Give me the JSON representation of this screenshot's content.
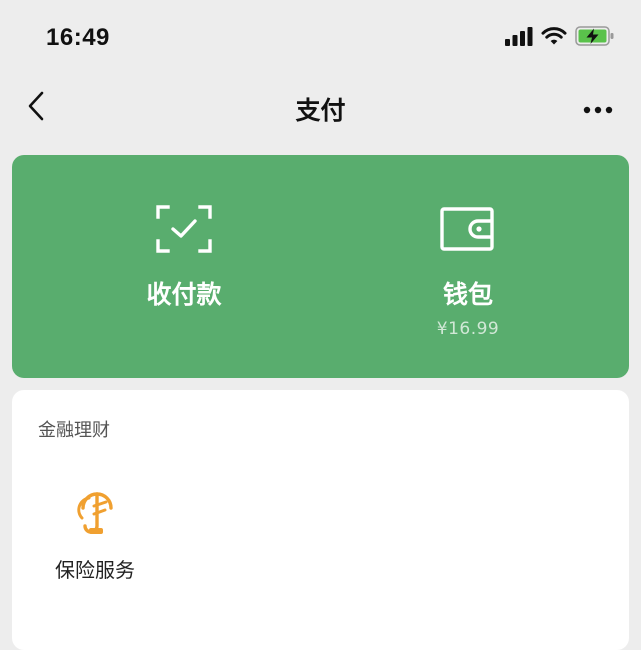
{
  "status_bar": {
    "time": "16:49",
    "icons": [
      "cellular-signal-icon",
      "wifi-icon",
      "battery-charging-icon"
    ],
    "battery_color": "#5ac24b"
  },
  "nav": {
    "title": "支付",
    "back_icon": "chevron-left-icon",
    "more_icon": "more-dots-icon"
  },
  "pay_panel": {
    "background": "#59ad6e",
    "collect": {
      "label": "收付款",
      "icon": "scan-check-icon"
    },
    "wallet": {
      "label": "钱包",
      "balance": "¥16.99",
      "icon": "wallet-icon"
    }
  },
  "finance": {
    "title": "金融理财",
    "items": [
      {
        "label": "保险服务",
        "icon": "insurance-umbrella-icon",
        "color": "#f0a030"
      }
    ]
  }
}
